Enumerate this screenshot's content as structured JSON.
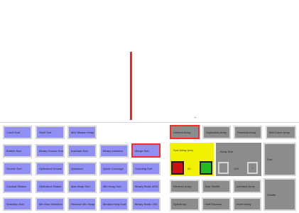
{
  "sort_buttons": [
    {
      "label": "Comb Sort"
    },
    {
      "label": "Shell Sort"
    },
    {
      "label": "MIU Median Heap"
    },
    {
      "label": "Bubble Sort"
    },
    {
      "label": "Binary Gnome Sort"
    },
    {
      "label": "Insertion Sort"
    },
    {
      "label": "Binary Insertion"
    },
    {
      "label": "Merge Sort"
    },
    {
      "label": "Gnome Sort"
    },
    {
      "label": "Optimized Gnome"
    },
    {
      "label": "Quicksort"
    },
    {
      "label": "Quick Converge"
    },
    {
      "label": "Counting Sort"
    },
    {
      "label": "Cocktail Shaker"
    },
    {
      "label": "Optimized Shaker"
    },
    {
      "label": "Max Heap Sort"
    },
    {
      "label": "Min Heap Sort"
    },
    {
      "label": "Binary Radix MSD"
    },
    {
      "label": "Selection Sort"
    },
    {
      "label": "Min Max Selection"
    },
    {
      "label": "Reverse Min Heap"
    },
    {
      "label": "Median Heap Sort"
    },
    {
      "label": "Binary Radix LSD"
    }
  ],
  "array_buttons": {
    "uniform": "Uniform Array",
    "duplicates": "Duplicates Array",
    "parabola": "Parabola Array",
    "bell_curve": "Bell Curve Array",
    "reverse": "Reverse Array",
    "bad_shuffle": "Bad Shuffle",
    "interlace": "Interlace Array",
    "split": "Split Array",
    "half_reverse": "Half Reverse",
    "invert": "Invert Array",
    "sort": "Sort",
    "shuffle": "Shuffle"
  },
  "delay": {
    "label": "Sort Delay (ms)",
    "value": "20"
  },
  "size": {
    "label": "Array Size",
    "minus": "-",
    "value": "128",
    "plus": "+"
  },
  "colors": {
    "sort_button": "#8f8ff4",
    "util_button": "#8c8c8c",
    "selected_border": "#ff2a2a",
    "delay_panel": "#f2f200",
    "stop": "#cc1111",
    "go": "#22bb22"
  }
}
